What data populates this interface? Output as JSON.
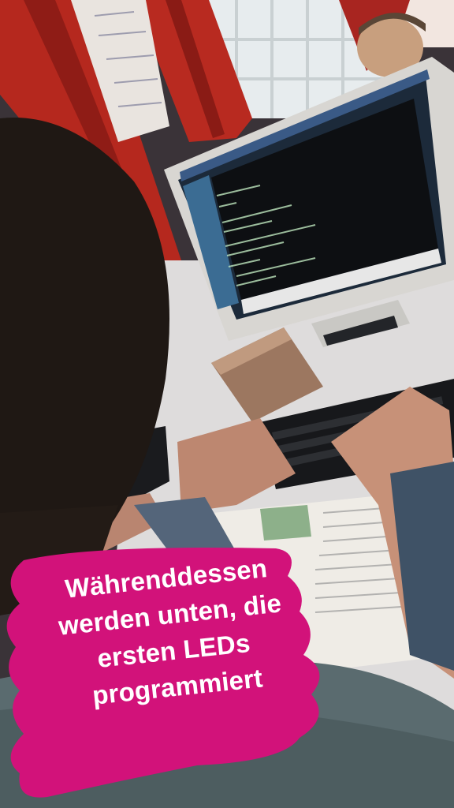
{
  "caption": {
    "lines": [
      "Währenddessen",
      "werden unten, die",
      "ersten LEDs",
      "programmiert"
    ],
    "background_color": "#d2127a",
    "text_color": "#ffffff"
  },
  "scene": {
    "description_icons": [
      "monitor-icon",
      "keyboard-icon",
      "book-icon",
      "curtain-icon"
    ]
  }
}
